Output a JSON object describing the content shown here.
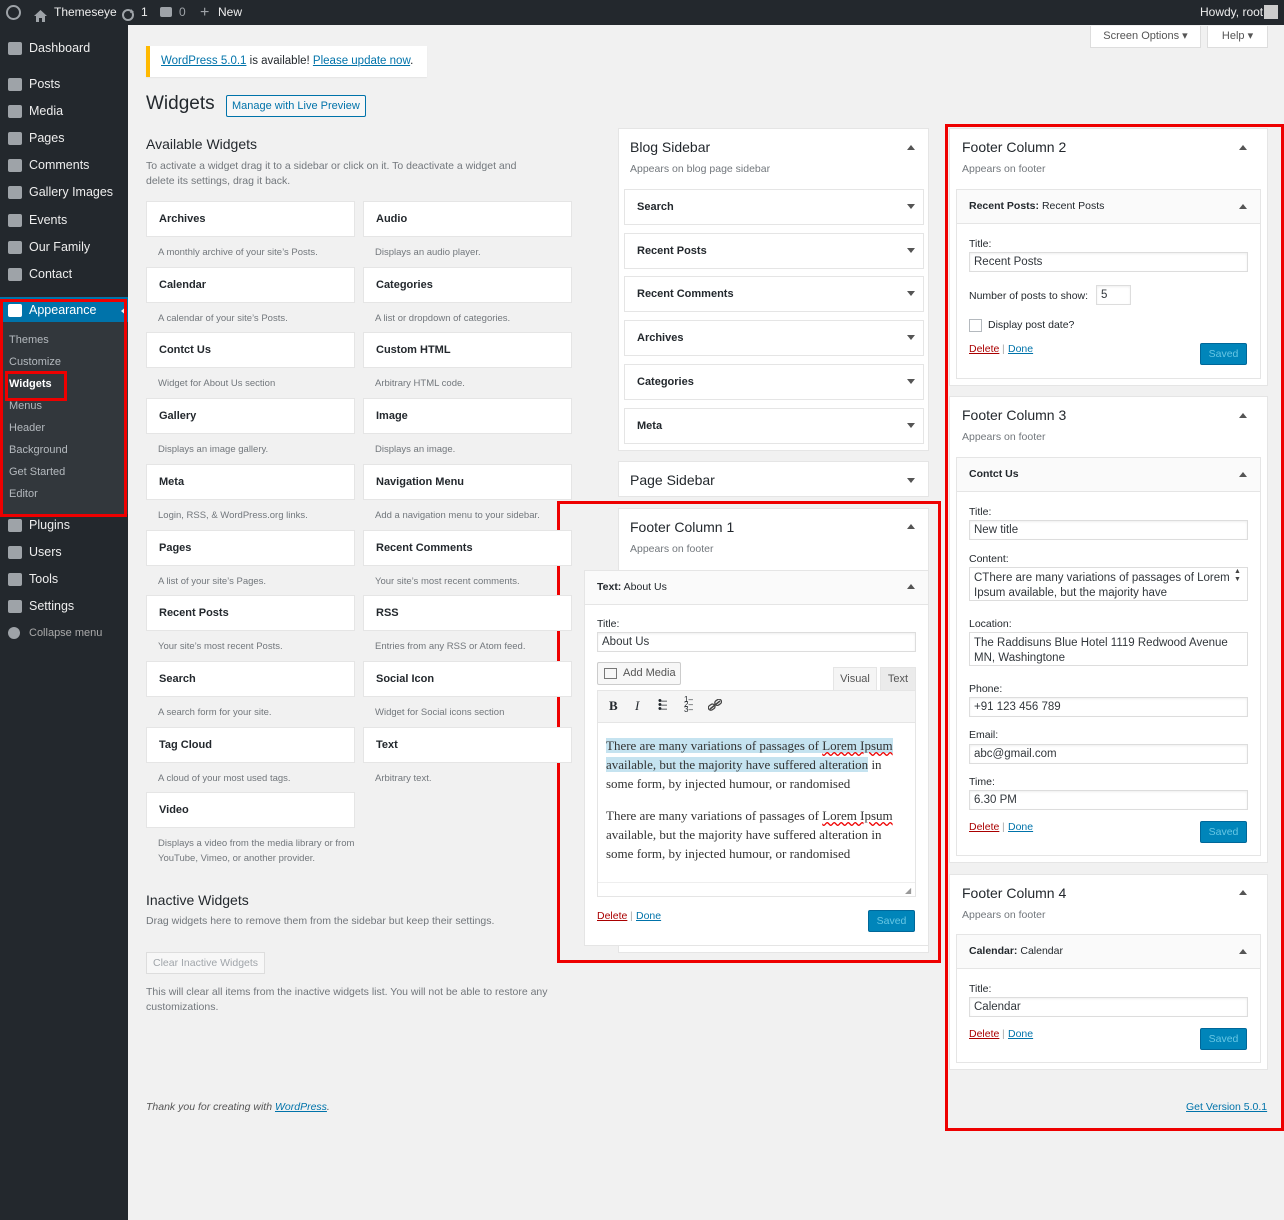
{
  "adminbar": {
    "site": "Themeseye",
    "updates": "1",
    "comments": "0",
    "new": "New",
    "howdy": "Howdy, root"
  },
  "menu": {
    "dashboard": "Dashboard",
    "posts": "Posts",
    "media": "Media",
    "pages": "Pages",
    "comments": "Comments",
    "gallery": "Gallery Images",
    "events": "Events",
    "family": "Our Family",
    "contact": "Contact",
    "appearance": "Appearance",
    "plugins": "Plugins",
    "users": "Users",
    "tools": "Tools",
    "settings": "Settings",
    "collapse": "Collapse menu",
    "sub": {
      "themes": "Themes",
      "customize": "Customize",
      "widgets": "Widgets",
      "menus": "Menus",
      "header": "Header",
      "background": "Background",
      "getstarted": "Get Started",
      "editor": "Editor"
    }
  },
  "top": {
    "screen_options": "Screen Options",
    "help": "Help"
  },
  "notice": {
    "version_link": "WordPress 5.0.1",
    "middle": " is available! ",
    "update_link": "Please update now",
    "end": "."
  },
  "page": {
    "title": "Widgets",
    "live_preview": "Manage with Live Preview"
  },
  "available": {
    "heading": "Available Widgets",
    "desc": "To activate a widget drag it to a sidebar or click on it. To deactivate a widget and delete its settings, drag it back.",
    "widgets": [
      {
        "name": "Archives",
        "desc": "A monthly archive of your site’s Posts."
      },
      {
        "name": "Audio",
        "desc": "Displays an audio player."
      },
      {
        "name": "Calendar",
        "desc": "A calendar of your site’s Posts."
      },
      {
        "name": "Categories",
        "desc": "A list or dropdown of categories."
      },
      {
        "name": "Contct Us",
        "desc": "Widget for About Us section"
      },
      {
        "name": "Custom HTML",
        "desc": "Arbitrary HTML code."
      },
      {
        "name": "Gallery",
        "desc": "Displays an image gallery."
      },
      {
        "name": "Image",
        "desc": "Displays an image."
      },
      {
        "name": "Meta",
        "desc": "Login, RSS, & WordPress.org links."
      },
      {
        "name": "Navigation Menu",
        "desc": "Add a navigation menu to your sidebar."
      },
      {
        "name": "Pages",
        "desc": "A list of your site’s Pages."
      },
      {
        "name": "Recent Comments",
        "desc": "Your site’s most recent comments."
      },
      {
        "name": "Recent Posts",
        "desc": "Your site’s most recent Posts."
      },
      {
        "name": "RSS",
        "desc": "Entries from any RSS or Atom feed."
      },
      {
        "name": "Search",
        "desc": "A search form for your site."
      },
      {
        "name": "Social Icon",
        "desc": "Widget for Social icons section"
      },
      {
        "name": "Tag Cloud",
        "desc": "A cloud of your most used tags."
      },
      {
        "name": "Text",
        "desc": "Arbitrary text."
      },
      {
        "name": "Video",
        "desc": "Displays a video from the media library or from YouTube, Vimeo, or another provider."
      }
    ]
  },
  "inactive": {
    "heading": "Inactive Widgets",
    "desc": "Drag widgets here to remove them from the sidebar but keep their settings.",
    "clear": "Clear Inactive Widgets",
    "note": "This will clear all items from the inactive widgets list. You will not be able to restore any customizations."
  },
  "footer": {
    "thanks": "Thank you for creating with ",
    "wp": "WordPress",
    "dot": ".",
    "version": "Get Version 5.0.1"
  },
  "blog_sidebar": {
    "title": "Blog Sidebar",
    "desc": "Appears on blog page sidebar",
    "items": [
      "Search",
      "Recent Posts",
      "Recent Comments",
      "Archives",
      "Categories",
      "Meta"
    ]
  },
  "page_sidebar": {
    "title": "Page Sidebar"
  },
  "footer1": {
    "title": "Footer Column 1",
    "desc": "Appears on footer",
    "widget_type": "Text:",
    "widget_name": "About Us",
    "title_label": "Title:",
    "title_value": "About Us",
    "add_media": "Add Media",
    "tab_visual": "Visual",
    "tab_text": "Text",
    "para1_a": "There are many variations of passages of ",
    "para1_b": "Lorem Ipsum",
    "para1_c": " available, but the majority have suffered alteration",
    "para1_d": " in some form, by injected humour, or randomised",
    "para2_a": "There are many variations of passages of ",
    "para2_b": "Lorem Ipsum",
    "para2_c": " available, but the majority have suffered alteration in some form, by injected humour, or randomised",
    "delete": "Delete",
    "done": "Done",
    "sep": "|",
    "saved": "Saved"
  },
  "footer2": {
    "title": "Footer Column 2",
    "desc": "Appears on footer",
    "widget_type": "Recent Posts:",
    "widget_name": "Recent Posts",
    "title_label": "Title:",
    "title_value": "Recent Posts",
    "num_label": "Number of posts to show:",
    "num_value": "5",
    "date_label": "Display post date?",
    "delete": "Delete",
    "done": "Done",
    "sep": "|",
    "saved": "Saved"
  },
  "footer3": {
    "title": "Footer Column 3",
    "desc": "Appears on footer",
    "widget_name": "Contct Us",
    "title_label": "Title:",
    "title_value": "New title",
    "content_label": "Content:",
    "content_value": "CThere are many variations of passages of Lorem Ipsum available, but the majority have",
    "location_label": "Location:",
    "location_value": "The Raddisuns Blue Hotel 1119 Redwood Avenue MN, Washingtone",
    "phone_label": "Phone:",
    "phone_value": "+91 123 456 789",
    "email_label": "Email:",
    "email_value": "abc@gmail.com",
    "time_label": "Time:",
    "time_value": "6.30 PM",
    "delete": "Delete",
    "done": "Done",
    "sep": "|",
    "saved": "Saved"
  },
  "footer4": {
    "title": "Footer Column 4",
    "desc": "Appears on footer",
    "widget_type": "Calendar:",
    "widget_name": "Calendar",
    "title_label": "Title:",
    "title_value": "Calendar",
    "delete": "Delete",
    "done": "Done",
    "sep": "|",
    "saved": "Saved"
  }
}
